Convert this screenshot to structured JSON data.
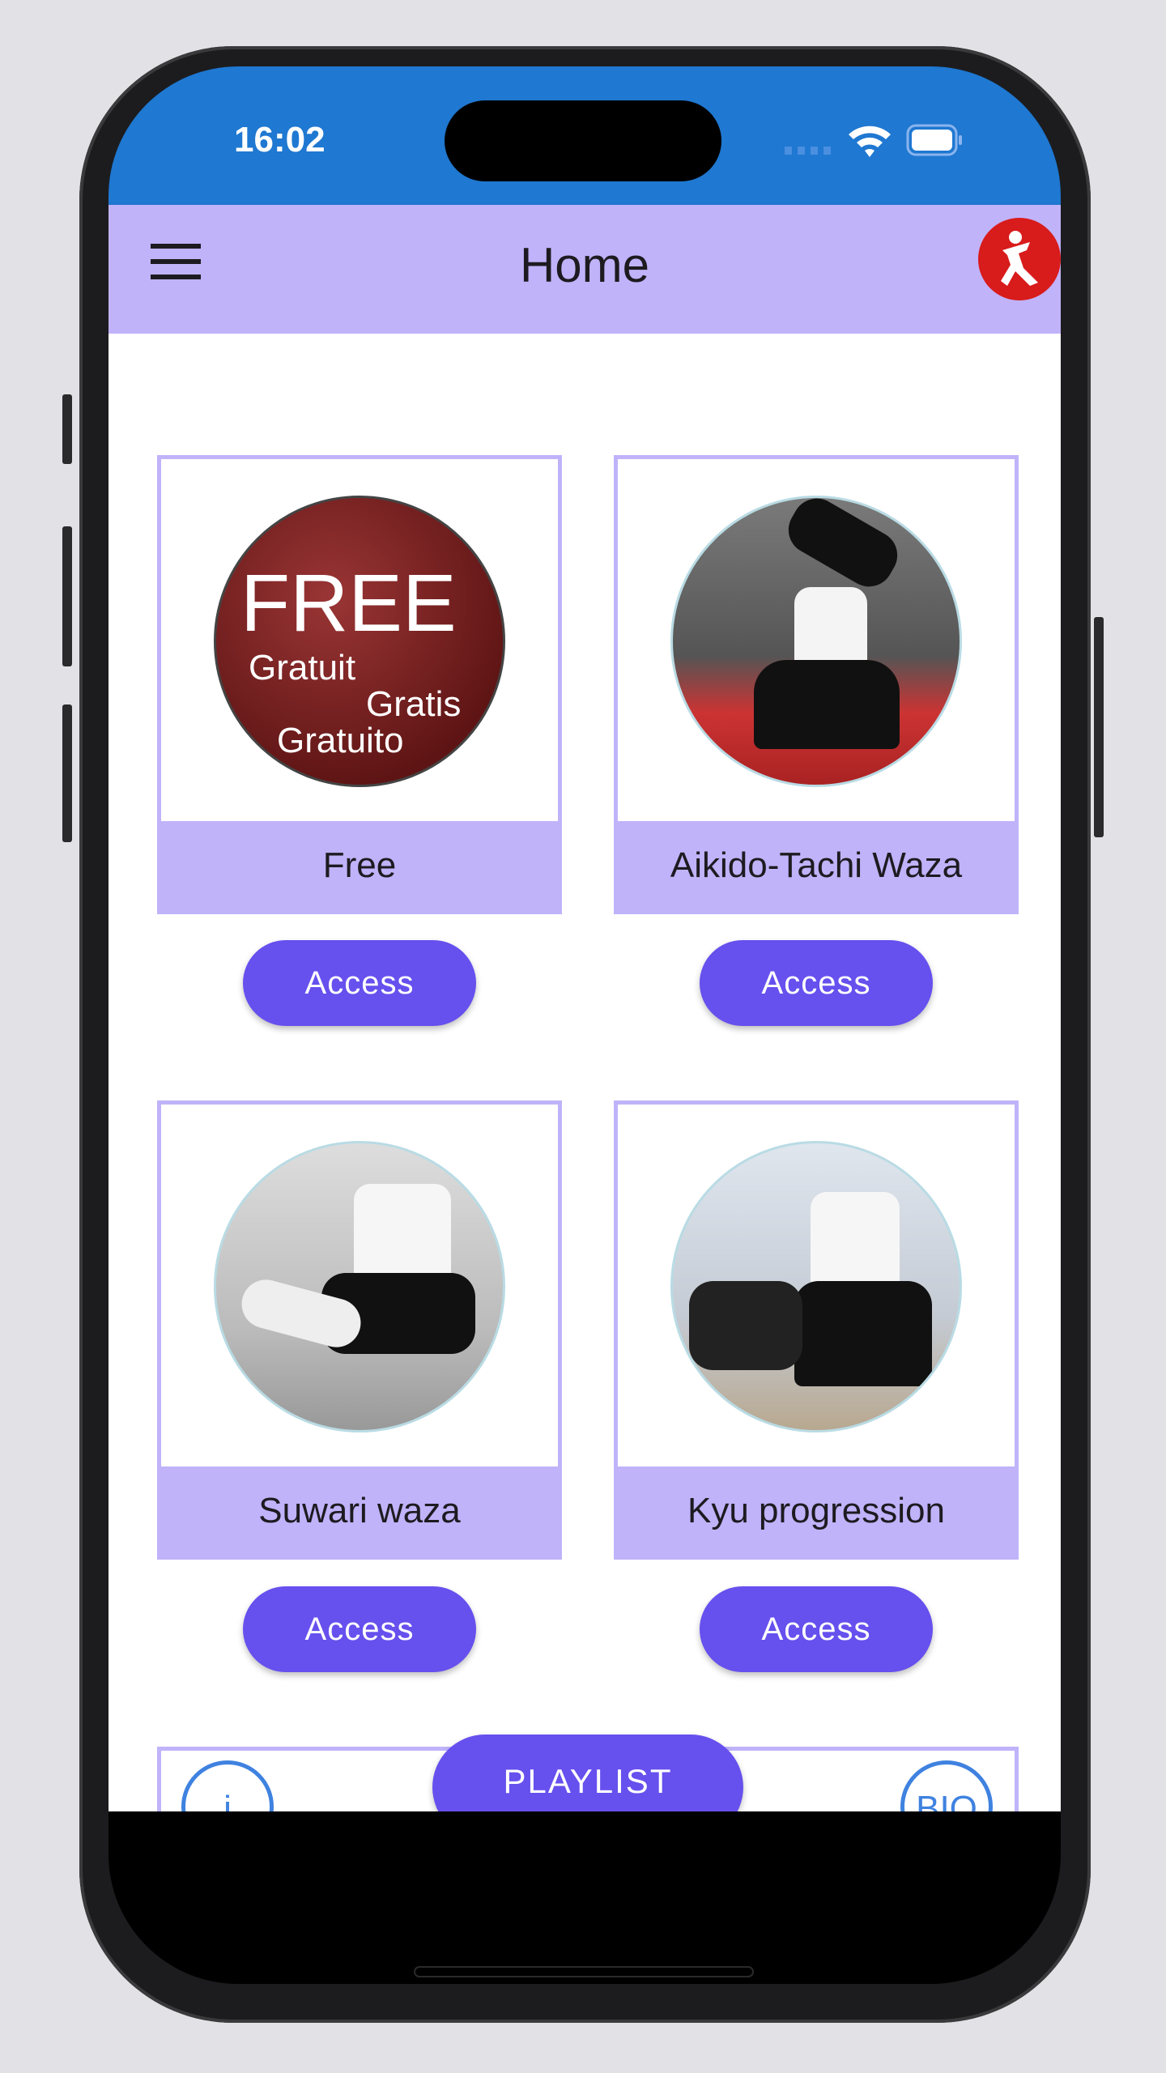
{
  "status_bar": {
    "time": "16:02",
    "icons": [
      "signal-icon",
      "wifi-icon",
      "battery-icon"
    ]
  },
  "app_bar": {
    "title": "Home",
    "menu_icon": "hamburger-menu-icon",
    "logo_icon": "karate-figure-logo"
  },
  "cards": [
    {
      "caption": "Free",
      "button": "Access",
      "image_text": [
        "FREE",
        "Gratuit",
        "Gratis",
        "Gratuito"
      ]
    },
    {
      "caption": "Aikido-Tachi Waza",
      "button": "Access"
    },
    {
      "caption": "Suwari waza",
      "button": "Access"
    },
    {
      "caption": "Kyu progression",
      "button": "Access"
    }
  ],
  "bottom": {
    "playlist": "PLAYLIST",
    "info": "i",
    "bio": "BIO"
  },
  "colors": {
    "status_bar": "#1f78d1",
    "app_bar": "#c0b3fa",
    "button": "#6650ee",
    "outline_blue": "#3f82e0"
  }
}
